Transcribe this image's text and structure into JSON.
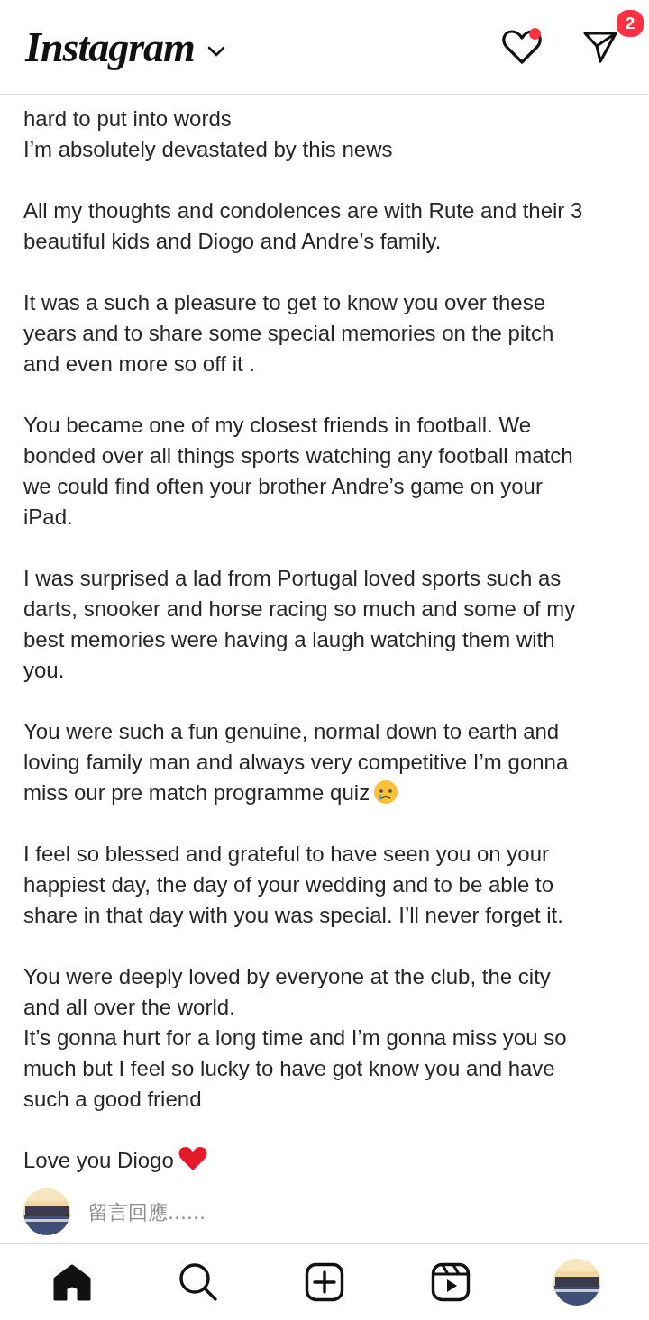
{
  "header": {
    "logo": "Instagram",
    "activity_dot": true,
    "messages_badge": "2"
  },
  "caption": [
    {
      "kind": "text",
      "lines": [
        "hard to put into words",
        "I’m absolutely devastated by this news"
      ]
    },
    {
      "kind": "text",
      "lines": [
        "All my thoughts and condolences are with Rute and their 3",
        "beautiful kids and Diogo and Andre’s family."
      ]
    },
    {
      "kind": "text",
      "lines": [
        "It was a such a pleasure to get to know you over these",
        "years and to share some special memories on the pitch",
        "and even more so off it ."
      ]
    },
    {
      "kind": "text",
      "lines": [
        "You became one of my closest friends in football. We",
        "bonded over all things sports watching any football match",
        "we could find often your brother Andre’s game on your",
        "iPad."
      ]
    },
    {
      "kind": "text",
      "lines": [
        "I was surprised a lad from Portugal loved sports such as",
        "darts, snooker and horse racing so much and some of my",
        "best memories were having a laugh watching them with",
        "you."
      ]
    },
    {
      "kind": "crying",
      "lines": [
        "You were such a fun genuine, normal down to earth and",
        "loving family man and always very competitive I’m gonna",
        "miss our pre match programme quiz"
      ]
    },
    {
      "kind": "text",
      "lines": [
        "I feel so blessed and grateful to have seen you on your",
        "happiest day, the day of your wedding and to be able to",
        "share in that day with you was special. I’ll never forget it."
      ]
    },
    {
      "kind": "text",
      "lines": [
        "You were deeply loved by everyone at the club, the city",
        "and all over the world.",
        "It’s gonna hurt for a long time and I’m gonna miss you so",
        "much but I feel so lucky to have got know you and have",
        "such a good friend"
      ]
    },
    {
      "kind": "heart",
      "lines": [
        "Love you Diogo"
      ]
    }
  ],
  "comment": {
    "placeholder": "留言回應......"
  },
  "nav": [
    {
      "kind": "home",
      "selected": true
    },
    {
      "kind": "search",
      "selected": false
    },
    {
      "kind": "create",
      "selected": false
    },
    {
      "kind": "reels",
      "selected": false
    },
    {
      "kind": "profile",
      "selected": false
    }
  ]
}
